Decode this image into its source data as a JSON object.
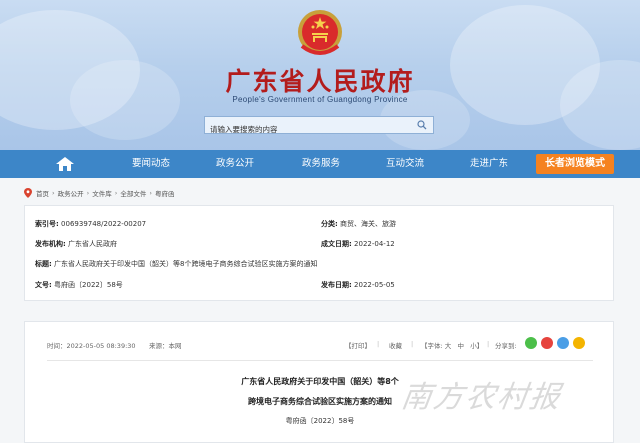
{
  "header": {
    "title": "广东省人民政府",
    "subtitle": "People's Government of Guangdong Province",
    "search_placeholder": "请输入要搜索的内容"
  },
  "nav": {
    "items": [
      "要闻动态",
      "政务公开",
      "政务服务",
      "互动交流",
      "走进广东"
    ],
    "elder_mode": "长者浏览模式"
  },
  "breadcrumb": [
    "首页",
    "政务公开",
    "文件库",
    "全部文件",
    "粤府函"
  ],
  "info": {
    "index_no_label": "索引号:",
    "index_no": "006939748/2022-00207",
    "category_label": "分类:",
    "category": "商贸、海关、旅游",
    "issuer_label": "发布机构:",
    "issuer": "广东省人民政府",
    "created_label": "成文日期:",
    "created": "2022-04-12",
    "title_label": "标题:",
    "title": "广东省人民政府关于印发中国（韶关）等8个跨境电子商务综合试验区实施方案的通知",
    "doc_no_label": "文号:",
    "doc_no": "粤府函〔2022〕58号",
    "published_label": "发布日期:",
    "published": "2022-05-05"
  },
  "article": {
    "time": "时间：2022-05-05 08:39:30",
    "source": "来源：本网",
    "print": "【打印】",
    "favorite": "收藏",
    "font_label": "【字体:",
    "font_large": "大",
    "font_medium": "中",
    "font_small": "小",
    "font_close": "】",
    "share_label": "分享到:",
    "title_line1": "广东省人民政府关于印发中国（韶关）等8个",
    "title_line2": "跨境电子商务综合试验区实施方案的通知",
    "doc_no": "粤府函〔2022〕58号"
  },
  "watermark": "南方农村报",
  "colors": {
    "nav": "#3d86c8",
    "elder_button": "#f58220",
    "title_red": "#b31c1c",
    "wechat": "#4cbf4a",
    "weibo": "#e6433d",
    "qq": "#4a9ee6",
    "qzone": "#f4b400"
  }
}
